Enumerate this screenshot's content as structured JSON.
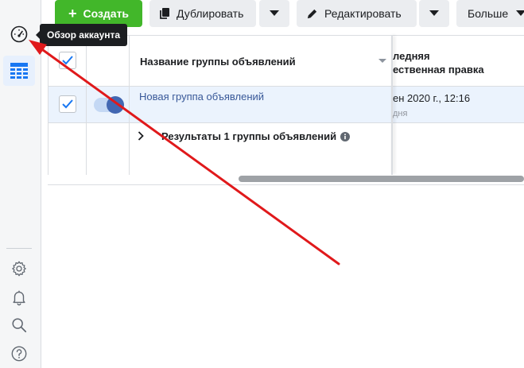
{
  "toolbar": {
    "create_label": "Создать",
    "duplicate_label": "Дублировать",
    "edit_label": "Редактировать",
    "more_label": "Больше"
  },
  "sidebar": {
    "tooltip": "Обзор аккаунта",
    "items": [
      {
        "icon": "gauge-icon",
        "active": false
      },
      {
        "icon": "table-icon",
        "active": true
      },
      {
        "icon": "gear-icon"
      },
      {
        "icon": "bell-icon"
      },
      {
        "icon": "search-icon"
      },
      {
        "icon": "help-icon"
      }
    ]
  },
  "table": {
    "columns": {
      "name": "Название группы объявлений",
      "last_edit_line1": "ледняя",
      "last_edit_line2": "ественная правка"
    },
    "rows": [
      {
        "name": "Новая группа объявлений",
        "checked": true,
        "toggle_on": true,
        "last_edit": "ен 2020 г., 12:16",
        "last_edit_sub": "дня"
      }
    ],
    "results_label": "Результаты 1 группы объявлений"
  },
  "colors": {
    "create_green": "#42b72a",
    "link_blue": "#385898",
    "selected_row": "#ebf3fd",
    "annotation_red": "#e0191b"
  }
}
